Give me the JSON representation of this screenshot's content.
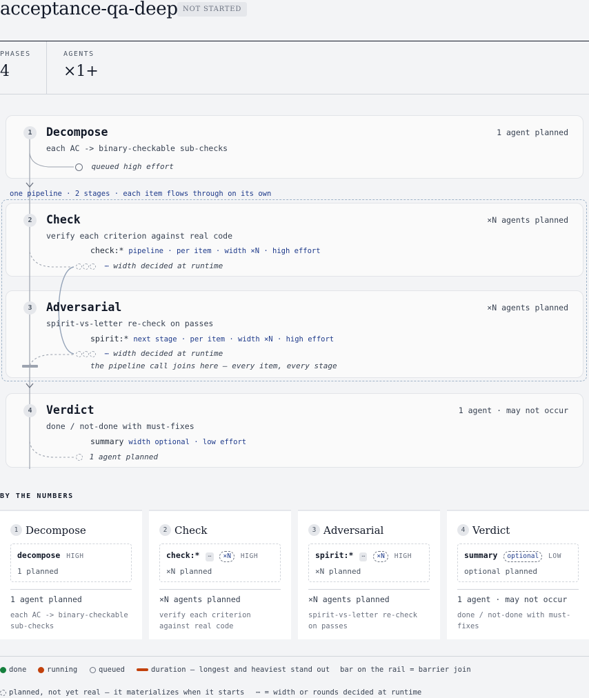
{
  "header": {
    "title": "acceptance-qa-deep",
    "status": "NOT STARTED"
  },
  "stats": [
    {
      "label": "PHASES",
      "value": "4"
    },
    {
      "label": "AGENTS",
      "value": "×1+"
    }
  ],
  "pipeline_caption": "one pipeline · 2 stages · each item flows through on its own",
  "phases": [
    {
      "num": "1",
      "title": "Decompose",
      "desc": "each AC -> binary-checkable sub-checks",
      "meta": "1 agent planned",
      "agent_note": "queued high effort"
    },
    {
      "num": "2",
      "title": "Check",
      "desc": "verify each criterion against real code",
      "meta": "×N agents planned",
      "agent": "check:*",
      "agent_extra": "pipeline · per item · width ×N · high effort",
      "note_glyph": "⋯",
      "note": "width decided at runtime"
    },
    {
      "num": "3",
      "title": "Adversarial",
      "desc": "spirit-vs-letter re-check on passes",
      "meta": "×N agents planned",
      "agent": "spirit:*",
      "agent_extra": "next stage · per item · width ×N · high effort",
      "note_glyph": "⋯",
      "note": "width decided at runtime",
      "join_note": "the pipeline call joins here — every item, every stage"
    },
    {
      "num": "4",
      "title": "Verdict",
      "desc": "done / not-done with must-fixes",
      "meta": "1 agent · may not occur",
      "agent": "summary",
      "agent_extra": "width optional · low effort",
      "note": "1 agent planned"
    }
  ],
  "numbers": {
    "heading": "BY THE NUMBERS",
    "cards": [
      {
        "num": "1",
        "title": "Decompose",
        "agent": "decompose",
        "chip": "",
        "pill": "",
        "effort": "HIGH",
        "planned": "1 planned",
        "summary": "1 agent planned",
        "desc": "each AC -> binary-checkable sub-checks"
      },
      {
        "num": "2",
        "title": "Check",
        "agent": "check:*",
        "chip": "⋯",
        "pill": "×N",
        "effort": "HIGH",
        "planned": "×N planned",
        "summary": "×N agents planned",
        "desc": "verify each criterion against real code"
      },
      {
        "num": "3",
        "title": "Adversarial",
        "agent": "spirit:*",
        "chip": "⋯",
        "pill": "×N",
        "effort": "HIGH",
        "planned": "×N planned",
        "summary": "×N agents planned",
        "desc": "spirit-vs-letter re-check on passes"
      },
      {
        "num": "4",
        "title": "Verdict",
        "agent": "summary",
        "chip": "",
        "pill": "optional",
        "effort": "LOW",
        "planned": "optional planned",
        "summary": "1 agent · may not occur",
        "desc": "done / not-done with must-fixes"
      }
    ]
  },
  "legend": {
    "done": "done",
    "running": "running",
    "queued": "queued",
    "duration": "duration — longest and heaviest stand out",
    "barrier": "bar on the rail = barrier join",
    "planned": "planned, not yet real — it materializes when it starts",
    "runtime": "⋯ = width or rounds decided at runtime"
  },
  "colors": {
    "done": "#15803d",
    "running": "#c2410c",
    "accent": "#1e3a8a",
    "rail": "#9ca3af"
  }
}
